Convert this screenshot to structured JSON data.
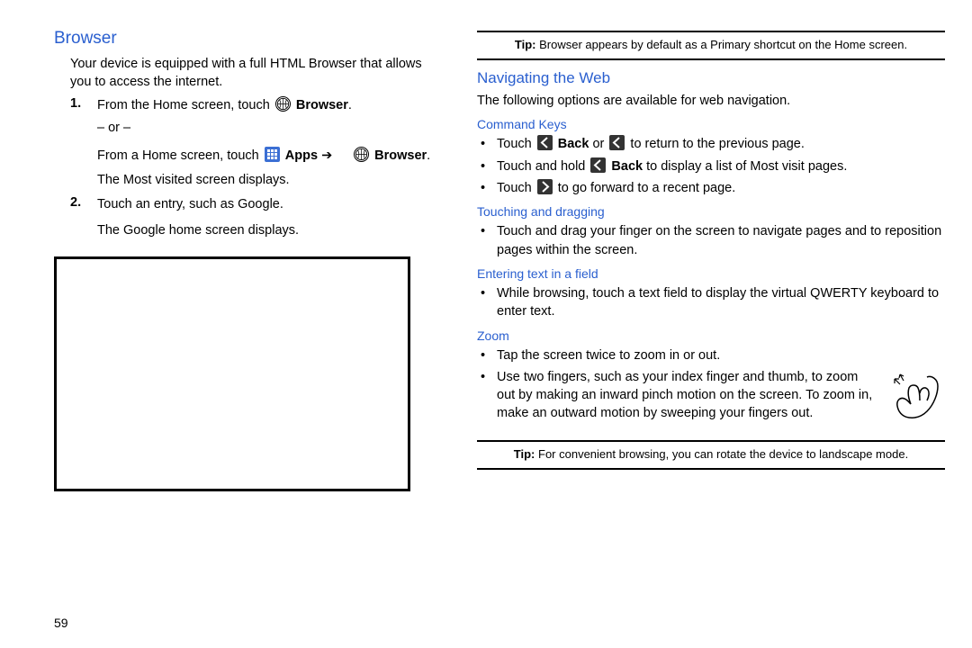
{
  "left": {
    "heading": "Browser",
    "intro": "Your device is equipped with a full HTML Browser that allows you to access the internet.",
    "step1_num": "1.",
    "step1_a": "From the Home screen, touch ",
    "step1_b": " Browser",
    "step1_c": ".",
    "or": "– or –",
    "step1_d": "From a Home screen, touch ",
    "step1_apps": " Apps",
    "step1_arrow": " ➔ ",
    "step1_browser2": " Browser",
    "step1_e": ".",
    "step1_f": "The Most visited screen displays.",
    "step2_num": "2.",
    "step2_a": "Touch an entry, such as Google.",
    "step2_b": "The Google home screen displays."
  },
  "right": {
    "tip1_label": "Tip:",
    "tip1_text": " Browser appears by default as a Primary shortcut on the Home screen.",
    "nav_heading": "Navigating the Web",
    "nav_intro": "The following options are available for web navigation.",
    "cmd_heading": "Command Keys",
    "cmd1_a": "Touch ",
    "cmd1_b": " Back",
    "cmd1_c": " or ",
    "cmd1_d": " to return to the previous page.",
    "cmd2_a": "Touch and hold ",
    "cmd2_b": " Back",
    "cmd2_c": " to display a list of Most visit pages.",
    "cmd3_a": "Touch ",
    "cmd3_b": " to go forward to a recent page.",
    "drag_heading": "Touching and dragging",
    "drag1": "Touch and drag your finger on the screen to navigate pages and to reposition pages within the screen.",
    "text_heading": "Entering text in a field",
    "text1": "While browsing, touch a text field to display the virtual QWERTY keyboard to enter text.",
    "zoom_heading": "Zoom",
    "zoom1": "Tap the screen twice to zoom in or out.",
    "zoom2": "Use two fingers, such as your index finger and thumb, to zoom out by making an inward pinch motion on the screen. To zoom in, make an outward motion by sweeping your fingers out.",
    "tip2_label": "Tip:",
    "tip2_text": " For convenient browsing, you can rotate the device to landscape mode."
  },
  "page_num": "59"
}
